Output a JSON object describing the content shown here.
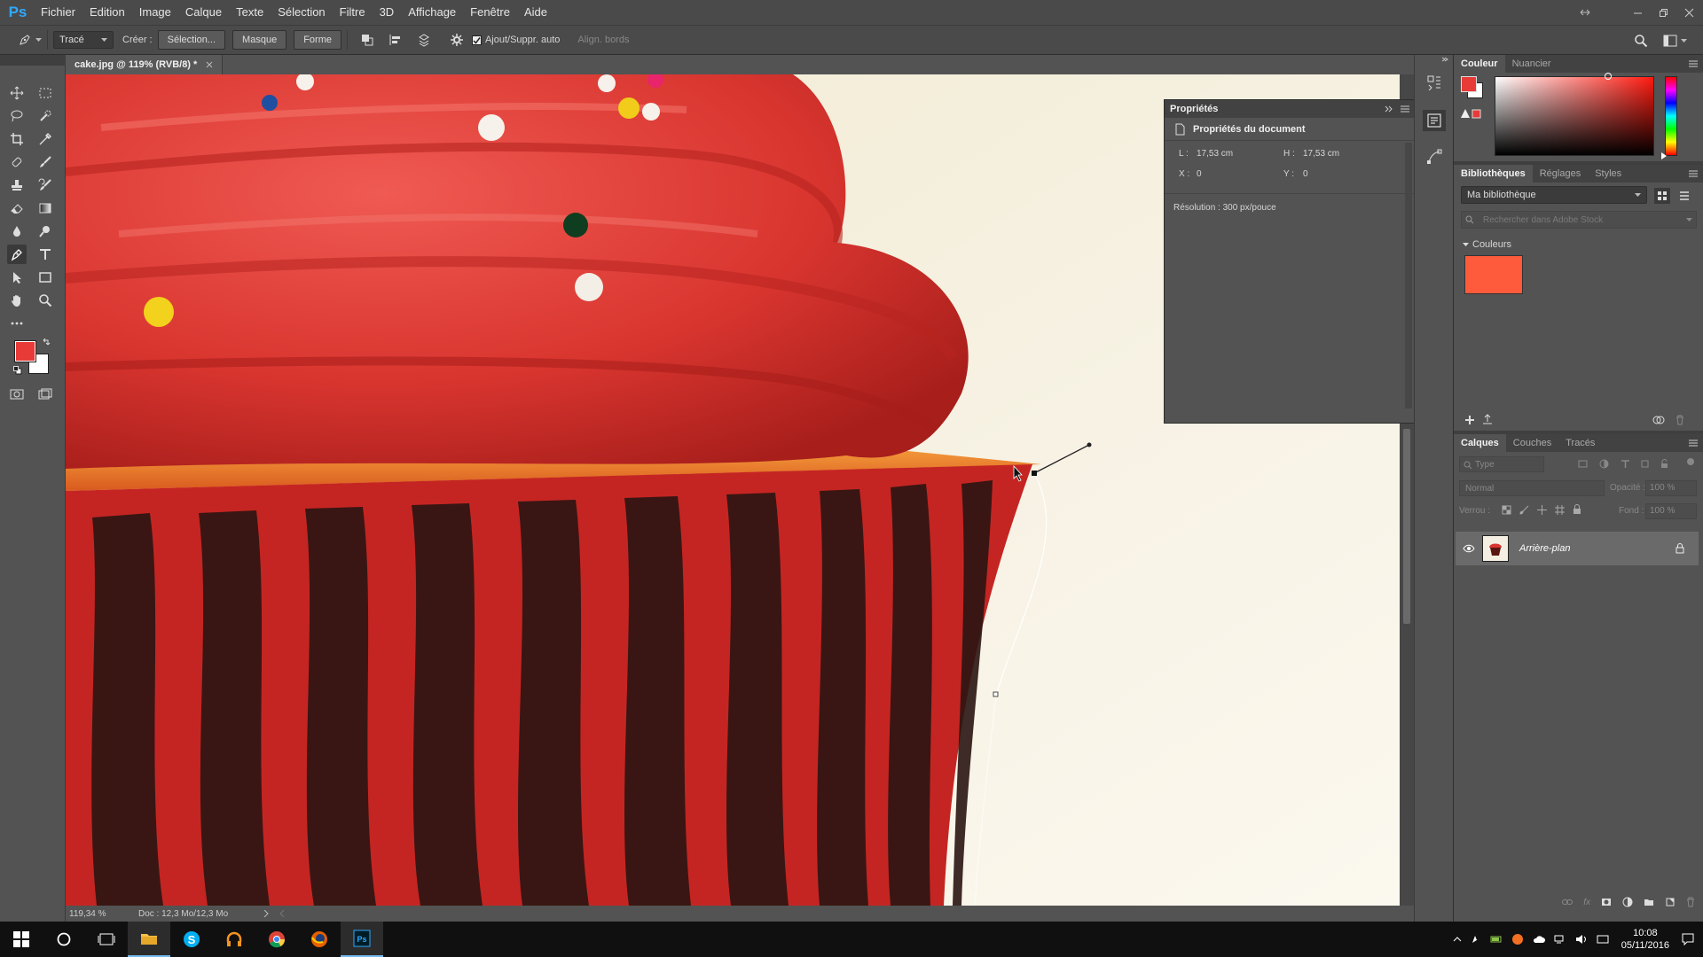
{
  "app": {
    "logo": "Ps"
  },
  "menu": [
    "Fichier",
    "Edition",
    "Image",
    "Calque",
    "Texte",
    "Sélection",
    "Filtre",
    "3D",
    "Affichage",
    "Fenêtre",
    "Aide"
  ],
  "options": {
    "mode_value": "Tracé",
    "create_label": "Créer :",
    "selection_btn": "Sélection...",
    "mask_btn": "Masque",
    "shape_btn": "Forme",
    "auto_add_label": "Ajout/Suppr. auto",
    "align_edges_label": "Align. bords"
  },
  "document": {
    "tab_title": "cake.jpg @ 119% (RVB/8) *"
  },
  "status": {
    "zoom": "119,34 %",
    "doc_info": "Doc : 12,3 Mo/12,3 Mo"
  },
  "properties": {
    "title": "Propriétés",
    "section": "Propriétés du document",
    "w_label": "L :",
    "w_value": "17,53 cm",
    "h_label": "H :",
    "h_value": "17,53 cm",
    "x_label": "X :",
    "x_value": "0",
    "y_label": "Y :",
    "y_value": "0",
    "resolution": "Résolution : 300 px/pouce"
  },
  "color_panel": {
    "tabs": [
      "Couleur",
      "Nuancier"
    ],
    "fg": "#e83b37",
    "bg": "#ffffff"
  },
  "libraries": {
    "tabs": [
      "Bibliothèques",
      "Réglages",
      "Styles"
    ],
    "library": "Ma bibliothèque",
    "search_placeholder": "Rechercher dans Adobe Stock",
    "section": "Couleurs",
    "swatch": "#fd5b3b"
  },
  "layers": {
    "tabs": [
      "Calques",
      "Couches",
      "Tracés"
    ],
    "filter": "Type",
    "blend": "Normal",
    "opacity_label": "Opacité :",
    "opacity_value": "100 %",
    "lock_label": "Verrou :",
    "fill_label": "Fond :",
    "fill_value": "100 %",
    "items": [
      {
        "name": "Arrière-plan"
      }
    ]
  },
  "taskbar": {
    "time": "10:08",
    "date": "05/11/2016"
  }
}
